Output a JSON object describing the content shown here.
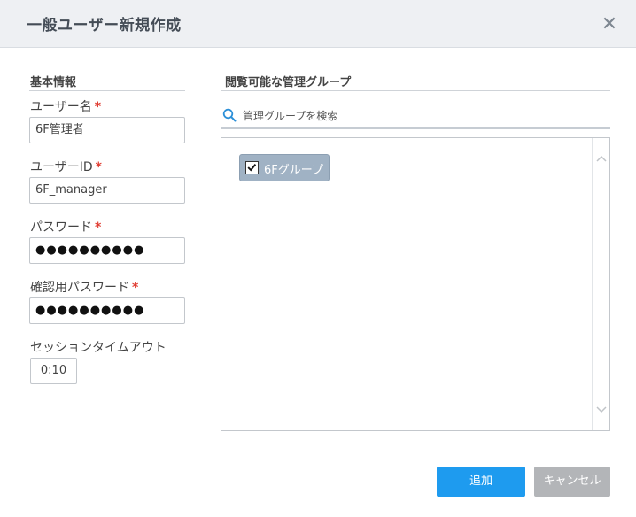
{
  "dialog": {
    "title": "一般ユーザー新規作成",
    "close_icon": "close-icon"
  },
  "basic_info": {
    "heading": "基本情報",
    "username": {
      "label": "ユーザー名",
      "required": "*",
      "value": "6F管理者"
    },
    "user_id": {
      "label": "ユーザーID",
      "required": "*",
      "value": "6F_manager"
    },
    "password": {
      "label": "パスワード",
      "required": "*",
      "value": "●●●●●●●●●●"
    },
    "confirm_password": {
      "label": "確認用パスワード",
      "required": "*",
      "value": "●●●●●●●●●●"
    },
    "session_timeout": {
      "label": "セッションタイムアウト",
      "value": "0:10"
    }
  },
  "groups": {
    "heading": "閲覧可能な管理グループ",
    "search": {
      "placeholder": "管理グループを検索",
      "icon": "search-icon"
    },
    "items": [
      {
        "label": "6Fグループ",
        "checked": true
      }
    ]
  },
  "footer": {
    "add_label": "追加",
    "cancel_label": "キャンセル"
  },
  "colors": {
    "primary": "#1e9bef",
    "disabled": "#b3b5b8",
    "required": "#e03c31",
    "chip": "#a0b2c4",
    "header_bg": "#eef0f3"
  }
}
